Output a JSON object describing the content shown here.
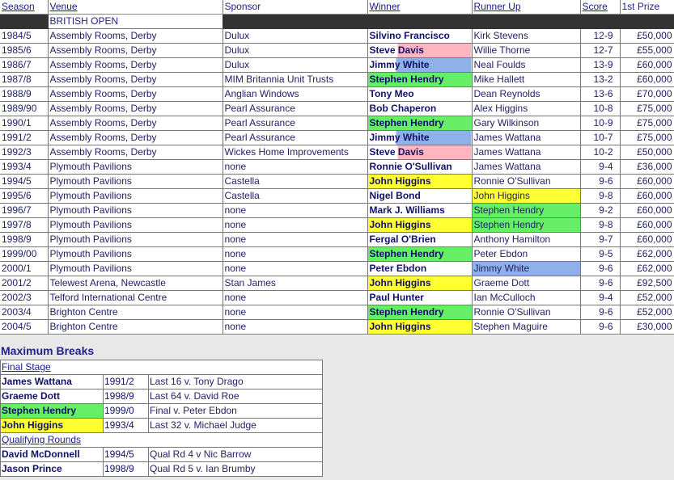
{
  "headers": {
    "season": "Season",
    "venue": "Venue",
    "sponsor": "Sponsor",
    "winner": "Winner",
    "runner_up": "Runner Up",
    "score": "Score",
    "prize": "1st Prize"
  },
  "tournament_title": "BRITISH OPEN",
  "rows": [
    {
      "season": "1984/5",
      "venue": "Assembly Rooms, Derby",
      "sponsor": "Dulux",
      "winner": "Silvino Francisco",
      "runner_up": "Kirk Stevens",
      "score": "12-9",
      "prize": "£50,000"
    },
    {
      "season": "1985/6",
      "venue": "Assembly Rooms, Derby",
      "sponsor": "Dulux",
      "winner": "Steve Davis",
      "runner_up": "Willie Thorne",
      "score": "12-7",
      "prize": "£55,000"
    },
    {
      "season": "1986/7",
      "venue": "Assembly Rooms, Derby",
      "sponsor": "Dulux",
      "winner": "Jimmy White",
      "runner_up": "Neal Foulds",
      "score": "13-9",
      "prize": "£60,000"
    },
    {
      "season": "1987/8",
      "venue": "Assembly Rooms, Derby",
      "sponsor": "MIM Britannia Unit Trusts",
      "winner": "Stephen Hendry",
      "runner_up": "Mike Hallett",
      "score": "13-2",
      "prize": "£60,000"
    },
    {
      "season": "1988/9",
      "venue": "Assembly Rooms, Derby",
      "sponsor": "Anglian Windows",
      "winner": "Tony Meo",
      "runner_up": "Dean Reynolds",
      "score": "13-6",
      "prize": "£70,000"
    },
    {
      "season": "1989/90",
      "venue": "Assembly Rooms, Derby",
      "sponsor": "Pearl Assurance",
      "winner": "Bob Chaperon",
      "runner_up": "Alex Higgins",
      "score": "10-8",
      "prize": "£75,000"
    },
    {
      "season": "1990/1",
      "venue": "Assembly Rooms, Derby",
      "sponsor": "Pearl Assurance",
      "winner": "Stephen Hendry",
      "runner_up": "Gary Wilkinson",
      "score": "10-9",
      "prize": "£75,000"
    },
    {
      "season": "1991/2",
      "venue": "Assembly Rooms, Derby",
      "sponsor": "Pearl Assurance",
      "winner": "Jimmy White",
      "runner_up": "James Wattana",
      "score": "10-7",
      "prize": "£75,000"
    },
    {
      "season": "1992/3",
      "venue": "Assembly Rooms, Derby",
      "sponsor": "Wickes Home Improvements",
      "winner": "Steve Davis",
      "runner_up": "James Wattana",
      "score": "10-2",
      "prize": "£50,000"
    },
    {
      "season": "1993/4",
      "venue": "Plymouth Pavilions",
      "sponsor": "none",
      "winner": "Ronnie O'Sullivan",
      "runner_up": "James Wattana",
      "score": "9-4",
      "prize": "£36,000"
    },
    {
      "season": "1994/5",
      "venue": "Plymouth Pavilions",
      "sponsor": "Castella",
      "winner": "John Higgins",
      "runner_up": "Ronnie O'Sullivan",
      "score": "9-6",
      "prize": "£60,000"
    },
    {
      "season": "1995/6",
      "venue": "Plymouth Pavilions",
      "sponsor": "Castella",
      "winner": "Nigel Bond",
      "runner_up": "John Higgins",
      "score": "9-8",
      "prize": "£60,000"
    },
    {
      "season": "1996/7",
      "venue": "Plymouth Pavilions",
      "sponsor": "none",
      "winner": "Mark J. Williams",
      "runner_up": "Stephen Hendry",
      "score": "9-2",
      "prize": "£60,000"
    },
    {
      "season": "1997/8",
      "venue": "Plymouth Pavilions",
      "sponsor": "none",
      "winner": "John Higgins",
      "runner_up": "Stephen Hendry",
      "score": "9-8",
      "prize": "£60,000"
    },
    {
      "season": "1998/9",
      "venue": "Plymouth Pavilions",
      "sponsor": "none",
      "winner": "Fergal O'Brien",
      "runner_up": "Anthony Hamilton",
      "score": "9-7",
      "prize": "£60,000"
    },
    {
      "season": "1999/00",
      "venue": "Plymouth Pavilions",
      "sponsor": "none",
      "winner": "Stephen Hendry",
      "runner_up": "Peter Ebdon",
      "score": "9-5",
      "prize": "£62,000"
    },
    {
      "season": "2000/1",
      "venue": "Plymouth Pavilions",
      "sponsor": "none",
      "winner": "Peter Ebdon",
      "runner_up": "Jimmy White",
      "score": "9-6",
      "prize": "£62,000"
    },
    {
      "season": "2001/2",
      "venue": "Telewest Arena, Newcastle",
      "sponsor": "Stan James",
      "winner": "John Higgins",
      "runner_up": "Graeme Dott",
      "score": "9-6",
      "prize": "£92,500"
    },
    {
      "season": "2002/3",
      "venue": "Telford International Centre",
      "sponsor": "none",
      "winner": "Paul Hunter",
      "runner_up": "Ian McCulloch",
      "score": "9-4",
      "prize": "£52,000"
    },
    {
      "season": "2003/4",
      "venue": "Brighton Centre",
      "sponsor": "none",
      "winner": "Stephen Hendry",
      "runner_up": "Ronnie O'Sullivan",
      "score": "9-6",
      "prize": "£52,000"
    },
    {
      "season": "2004/5",
      "venue": "Brighton Centre",
      "sponsor": "none",
      "winner": "John Higgins",
      "runner_up": "Stephen Maguire",
      "score": "9-6",
      "prize": "£30,000"
    }
  ],
  "colors": {
    "stephen_hendry": "#66ee66",
    "john_higgins": "#ffff33",
    "steve_davis": "#ffb6c1",
    "jimmy_white": "#8fb0e8"
  },
  "max_breaks": {
    "title": "Maximum Breaks",
    "final_stage_label": "Final Stage",
    "final_stage": [
      {
        "player": "James Wattana",
        "season": "1991/2",
        "detail": "Last 16 v. Tony Drago"
      },
      {
        "player": "Graeme Dott",
        "season": "1998/9",
        "detail": "Last 64 v. David Roe"
      },
      {
        "player": "Stephen Hendry",
        "season": "1999/0",
        "detail": "Final v. Peter Ebdon"
      },
      {
        "player": "John Higgins",
        "season": "1993/4",
        "detail": "Last 32 v. Michael Judge"
      }
    ],
    "qualifying_label": "Qualifying Rounds",
    "qualifying": [
      {
        "player": "David  McDonnell",
        "season": "1994/5",
        "detail": "Qual Rd 4 v Nic Barrow"
      },
      {
        "player": "Jason Prince",
        "season": "1998/9",
        "detail": "Qual Rd 5 v. Ian Brumby"
      }
    ]
  }
}
